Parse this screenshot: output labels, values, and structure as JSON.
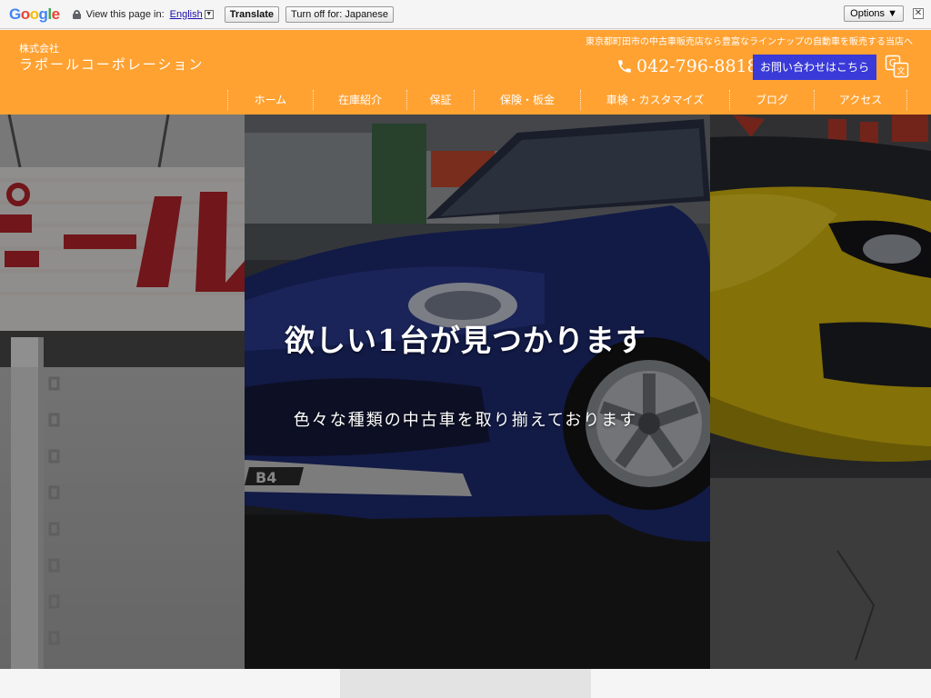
{
  "translate_bar": {
    "view_text": "View this page in:",
    "language": "English",
    "translate_label": "Translate",
    "turn_off_label": "Turn off for: Japanese",
    "options_label": "Options ▼",
    "close_glyph": "✕",
    "dropdown_glyph": "▼"
  },
  "header": {
    "company_prefix": "株式会社",
    "company_name": "ラポールコーポレーション",
    "tagline": "東京都町田市の中古車販売店なら豊富なラインナップの自動車を販売する当店へ",
    "phone": "042-796-8818",
    "contact_label": "お問い合わせはこちら",
    "translate_icon": "translate-icon"
  },
  "nav": {
    "items": [
      {
        "label": "ホーム"
      },
      {
        "label": "在庫紹介"
      },
      {
        "label": "保証"
      },
      {
        "label": "保険・板金"
      },
      {
        "label": "車検・カスタマイズ"
      },
      {
        "label": "ブログ"
      },
      {
        "label": "アクセス"
      }
    ]
  },
  "hero": {
    "title": "欲しい1台が見つかります",
    "subtitle": "色々な種類の中古車を取り揃えております"
  },
  "colors": {
    "header_orange": "#ffa232",
    "contact_blue": "#3a3ad8"
  }
}
